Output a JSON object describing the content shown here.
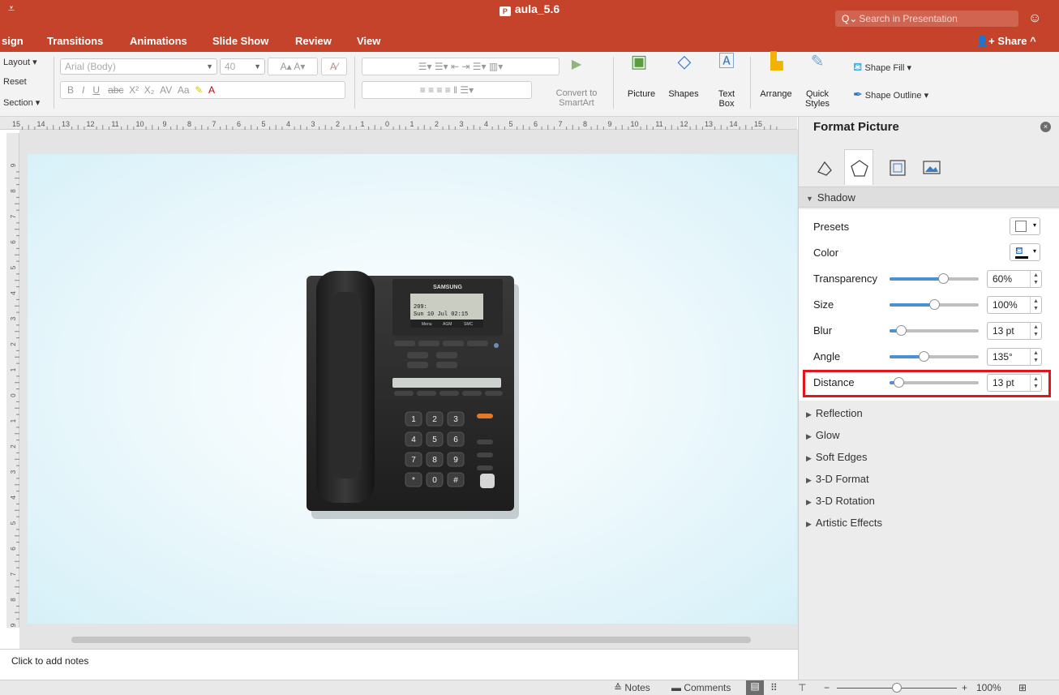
{
  "app": {
    "doc_title": "aula_5.6",
    "search_placeholder": "Search in Presentation",
    "qat_glyph": "⩡"
  },
  "tabs": [
    "sign",
    "Transitions",
    "Animations",
    "Slide Show",
    "Review",
    "View"
  ],
  "share_label": "Share",
  "ribbon": {
    "layout_label": "Layout",
    "reset_label": "Reset",
    "section_label": "Section",
    "font_name": "Arial (Body)",
    "font_size": "40",
    "convert_smartart": [
      "Convert to",
      "SmartArt"
    ],
    "picture_label": "Picture",
    "shapes_label": "Shapes",
    "textbox_label": [
      "Text",
      "Box"
    ],
    "arrange_label": "Arrange",
    "quick_styles_label": [
      "Quick",
      "Styles"
    ],
    "shape_fill_label": "Shape Fill",
    "shape_outline_label": "Shape Outline"
  },
  "ruler": {
    "h_labels": [
      "15",
      "14",
      "13",
      "12",
      "11",
      "10",
      "9",
      "8",
      "7",
      "6",
      "5",
      "4",
      "3",
      "2",
      "1",
      "0",
      "1",
      "2",
      "3",
      "4",
      "5",
      "6",
      "7",
      "8",
      "9",
      "10",
      "11",
      "12",
      "13",
      "14",
      "15"
    ],
    "v_labels": [
      "9",
      "8",
      "7",
      "6",
      "5",
      "4",
      "3",
      "2",
      "1",
      "0",
      "1",
      "2",
      "3",
      "4",
      "5",
      "6",
      "7",
      "8",
      "9"
    ]
  },
  "phone": {
    "brand": "SAMSUNG",
    "screen_lines": [
      "209:",
      "Sun 10 Jul 02:15"
    ],
    "softkeys": [
      "Menu",
      "AGM",
      "SMC"
    ],
    "keys": [
      "1",
      "2",
      "3",
      "4",
      "5",
      "6",
      "7",
      "8",
      "9",
      "*",
      "0",
      "#"
    ]
  },
  "notes_placeholder": "Click to add notes",
  "status": {
    "notes_label": "Notes",
    "comments_label": "Comments",
    "zoom_percent": "100%",
    "zoom_level": 0.5
  },
  "pane": {
    "title": "Format Picture",
    "section_shadow": "Shadow",
    "properties": [
      {
        "label": "Presets"
      },
      {
        "label": "Color"
      },
      {
        "label": "Transparency",
        "value": "60%",
        "level": 0.6
      },
      {
        "label": "Size",
        "value": "100%",
        "level": 0.5
      },
      {
        "label": "Blur",
        "value": "13 pt",
        "level": 0.13
      },
      {
        "label": "Angle",
        "value": "135°",
        "level": 0.38
      },
      {
        "label": "Distance",
        "value": "13 pt",
        "level": 0.1
      }
    ],
    "collapsed_sections": [
      "Reflection",
      "Glow",
      "Soft Edges",
      "3-D Format",
      "3-D Rotation",
      "Artistic Effects"
    ]
  }
}
